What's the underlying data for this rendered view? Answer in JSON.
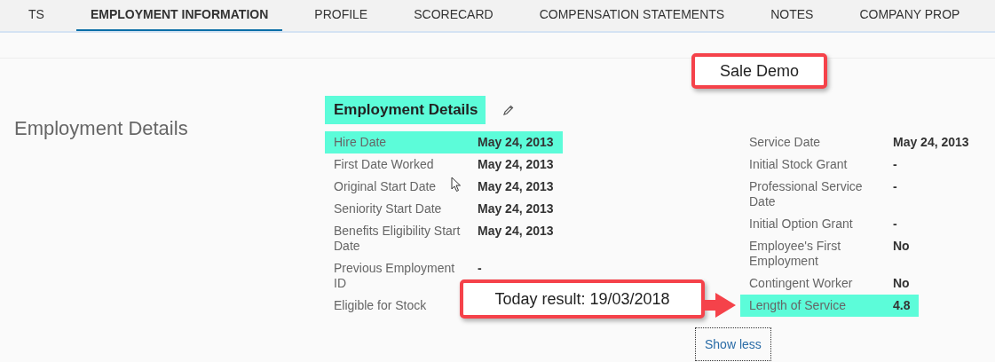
{
  "tabs": [
    {
      "label": "TS",
      "selected": false
    },
    {
      "label": "EMPLOYMENT INFORMATION",
      "selected": true
    },
    {
      "label": "PROFILE",
      "selected": false
    },
    {
      "label": "SCORECARD",
      "selected": false
    },
    {
      "label": "COMPENSATION STATEMENTS",
      "selected": false
    },
    {
      "label": "NOTES",
      "selected": false
    },
    {
      "label": "COMPANY PROP",
      "selected": false
    }
  ],
  "section_title": "Employment Details",
  "card": {
    "title": "Employment Details",
    "title_highlighted": true,
    "left_fields": [
      {
        "label": "Hire Date",
        "value": "May 24, 2013",
        "highlighted": true
      },
      {
        "label": "First Date Worked",
        "value": "May 24, 2013",
        "highlighted": false
      },
      {
        "label": "Original Start Date",
        "value": "May 24, 2013",
        "highlighted": false
      },
      {
        "label": "Seniority Start Date",
        "value": "May 24, 2013",
        "highlighted": false
      },
      {
        "label": "Benefits Eligibility Start Date",
        "value": "May 24, 2013",
        "highlighted": false
      },
      {
        "label": "Previous Employment ID",
        "value": "-",
        "highlighted": false
      },
      {
        "label": "Eligible for Stock",
        "highlighted": false
      }
    ],
    "right_fields": [
      {
        "label": "Service Date",
        "value": "May 24, 2013",
        "highlighted": false
      },
      {
        "label": "Initial Stock Grant",
        "value": "-",
        "highlighted": false
      },
      {
        "label": "Professional Service Date",
        "value": "-",
        "highlighted": false
      },
      {
        "label": "Initial Option Grant",
        "value": "-",
        "highlighted": false
      },
      {
        "label": "Employee's First Employment",
        "value": "No",
        "highlighted": false
      },
      {
        "label": "Contingent Worker",
        "value": "No",
        "highlighted": false
      },
      {
        "label": "Length of Service",
        "value": "4.8",
        "highlighted": true
      }
    ],
    "toggle_button": "Show less"
  },
  "annotations": [
    {
      "text": "Sale Demo",
      "arrow": false
    },
    {
      "text": "Today result: 19/03/2018",
      "arrow": true
    }
  ]
}
